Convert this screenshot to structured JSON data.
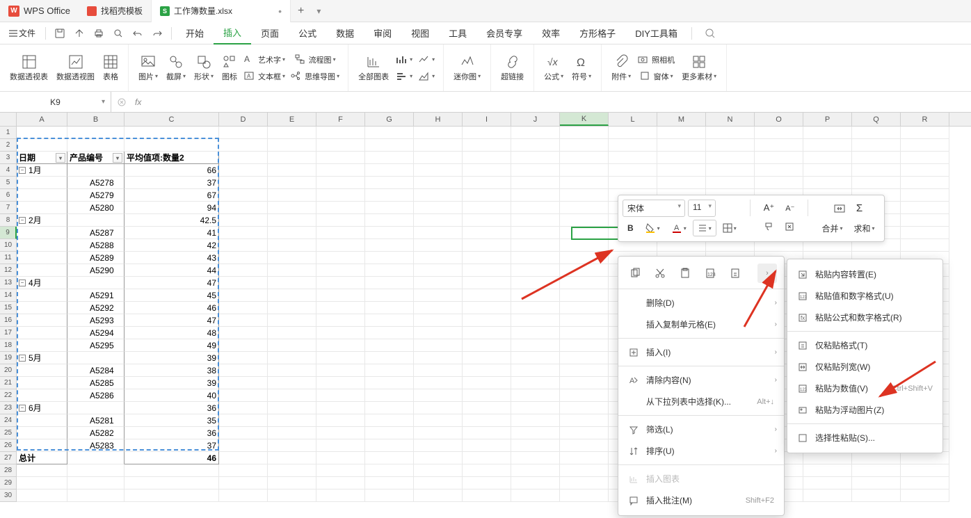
{
  "titlebar": {
    "app_name": "WPS Office",
    "tabs": [
      {
        "label": "找稻壳模板",
        "type": "docer"
      },
      {
        "label": "工作簿数量.xlsx",
        "type": "xlsx",
        "active": true,
        "modified": true
      }
    ]
  },
  "menubar": {
    "file": "文件",
    "tabs": [
      "开始",
      "插入",
      "页面",
      "公式",
      "数据",
      "审阅",
      "视图",
      "工具",
      "会员专享",
      "效率",
      "方形格子",
      "DIY工具箱"
    ],
    "active_tab": "插入"
  },
  "ribbon": {
    "items": {
      "pivot_table": "数据透视表",
      "pivot_chart": "数据透视图",
      "table": "表格",
      "picture": "图片",
      "screenshot": "截屏",
      "shape": "形状",
      "icon": "图标",
      "wordart": "艺术字",
      "textbox": "文本框",
      "flowchart": "流程图",
      "mindmap": "思维导图",
      "all_charts": "全部图表",
      "sparkline": "迷你图",
      "hyperlink": "超链接",
      "formula": "公式",
      "symbol": "符号",
      "attachment": "附件",
      "camera": "照相机",
      "form": "窗体",
      "more": "更多素材"
    }
  },
  "formula_bar": {
    "name_box": "K9"
  },
  "columns": [
    "A",
    "B",
    "C",
    "D",
    "E",
    "F",
    "G",
    "H",
    "I",
    "J",
    "K",
    "L",
    "M",
    "N",
    "O",
    "P",
    "Q",
    "R"
  ],
  "active_col": "K",
  "active_row": 9,
  "pivot": {
    "headers": [
      "日期",
      "产品编号",
      "平均值项:数量2"
    ],
    "rows": [
      {
        "r": 4,
        "a": "1月",
        "c": "66",
        "group": true
      },
      {
        "r": 5,
        "b": "A5278",
        "c": "37"
      },
      {
        "r": 6,
        "b": "A5279",
        "c": "67"
      },
      {
        "r": 7,
        "b": "A5280",
        "c": "94"
      },
      {
        "r": 8,
        "a": "2月",
        "c": "42.5",
        "group": true
      },
      {
        "r": 9,
        "b": "A5287",
        "c": "41"
      },
      {
        "r": 10,
        "b": "A5288",
        "c": "42"
      },
      {
        "r": 11,
        "b": "A5289",
        "c": "43"
      },
      {
        "r": 12,
        "b": "A5290",
        "c": "44"
      },
      {
        "r": 13,
        "a": "4月",
        "c": "47",
        "group": true
      },
      {
        "r": 14,
        "b": "A5291",
        "c": "45"
      },
      {
        "r": 15,
        "b": "A5292",
        "c": "46"
      },
      {
        "r": 16,
        "b": "A5293",
        "c": "47"
      },
      {
        "r": 17,
        "b": "A5294",
        "c": "48"
      },
      {
        "r": 18,
        "b": "A5295",
        "c": "49"
      },
      {
        "r": 19,
        "a": "5月",
        "c": "39",
        "group": true
      },
      {
        "r": 20,
        "b": "A5284",
        "c": "38"
      },
      {
        "r": 21,
        "b": "A5285",
        "c": "39"
      },
      {
        "r": 22,
        "b": "A5286",
        "c": "40"
      },
      {
        "r": 23,
        "a": "6月",
        "c": "36",
        "group": true
      },
      {
        "r": 24,
        "b": "A5281",
        "c": "35"
      },
      {
        "r": 25,
        "b": "A5282",
        "c": "36"
      },
      {
        "r": 26,
        "b": "A5283",
        "c": "37"
      },
      {
        "r": 27,
        "a": "总计",
        "c": "46",
        "total": true
      }
    ]
  },
  "mini_toolbar": {
    "font": "宋体",
    "size": "11",
    "merge": "合并",
    "sum": "求和"
  },
  "context_menu": {
    "delete": "删除(D)",
    "insert_copied": "插入复制单元格(E)",
    "insert": "插入(I)",
    "clear": "清除内容(N)",
    "from_dropdown": "从下拉列表中选择(K)...",
    "from_dropdown_sc": "Alt+↓",
    "filter": "筛选(L)",
    "sort": "排序(U)",
    "insert_chart": "插入图表",
    "insert_comment": "插入批注(M)",
    "insert_comment_sc": "Shift+F2"
  },
  "submenu": {
    "paste_transpose": "粘贴内容转置(E)",
    "paste_values_formats": "粘贴值和数字格式(U)",
    "paste_formulas_formats": "粘贴公式和数字格式(R)",
    "paste_formats": "仅粘贴格式(T)",
    "paste_col_width": "仅粘贴列宽(W)",
    "paste_values": "粘贴为数值(V)",
    "paste_values_sc": "Ctrl+Shift+V",
    "paste_image": "粘贴为浮动图片(Z)",
    "paste_special": "选择性粘贴(S)..."
  }
}
